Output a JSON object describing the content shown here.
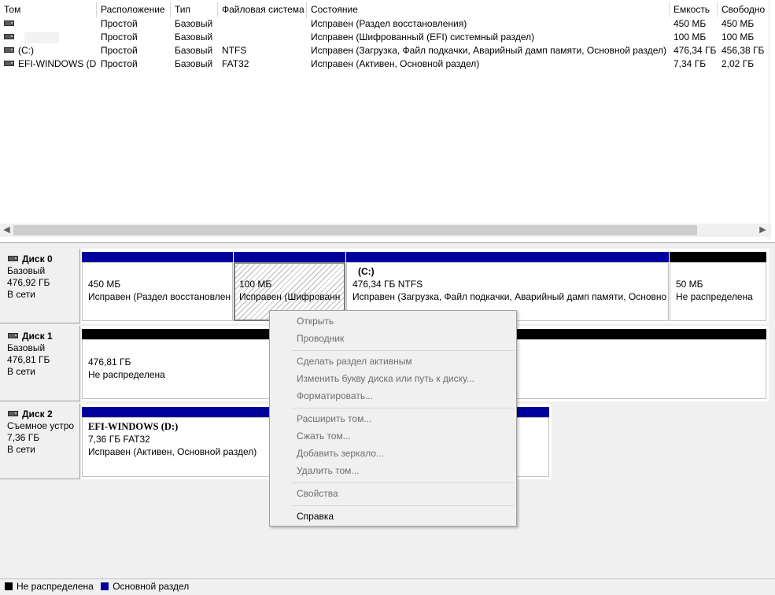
{
  "columns": [
    "Том",
    "Расположение",
    "Тип",
    "Файловая система",
    "Состояние",
    "Емкость",
    "Свободно"
  ],
  "volumes": [
    {
      "name": "",
      "layout": "Простой",
      "type": "Базовый",
      "fs": "",
      "status": "Исправен (Раздел восстановления)",
      "capacity": "450 МБ",
      "free": "450 МБ"
    },
    {
      "name": "",
      "layout": "Простой",
      "type": "Базовый",
      "fs": "",
      "status": "Исправен (Шифрованный (EFI) системный раздел)",
      "capacity": "100 МБ",
      "free": "100 МБ"
    },
    {
      "name": "(C:)",
      "layout": "Простой",
      "type": "Базовый",
      "fs": "NTFS",
      "status": "Исправен (Загрузка, Файл подкачки, Аварийный дамп памяти, Основной раздел)",
      "capacity": "476,34 ГБ",
      "free": "456,38 ГБ"
    },
    {
      "name": "EFI-WINDOWS (D:)",
      "layout": "Простой",
      "type": "Базовый",
      "fs": "FAT32",
      "status": "Исправен (Активен, Основной раздел)",
      "capacity": "7,34 ГБ",
      "free": "2,02 ГБ"
    }
  ],
  "disks": [
    {
      "name": "Диск 0",
      "type": "Базовый",
      "size": "476,92 ГБ",
      "state": "В сети",
      "partitions": [
        {
          "title": "",
          "size": "450 МБ",
          "status": "Исправен (Раздел восстановлен"
        },
        {
          "title": "",
          "size": "100 МБ",
          "status": "Исправен (Шифрованн"
        },
        {
          "title": "(C:)",
          "size": "476,34 ГБ NTFS",
          "status": "Исправен (Загрузка, Файл подкачки, Аварийный дамп памяти, Основно"
        },
        {
          "title": "",
          "size": "50 МБ",
          "status": "Не распределена"
        }
      ]
    },
    {
      "name": "Диск 1",
      "type": "Базовый",
      "size": "476,81 ГБ",
      "state": "В сети",
      "partitions": [
        {
          "title": "",
          "size": "476,81 ГБ",
          "status": "Не распределена"
        }
      ]
    },
    {
      "name": "Диск 2",
      "type": "Съемное устро",
      "size": "7,36 ГБ",
      "state": "В сети",
      "partitions": [
        {
          "title": "EFI-WINDOWS  (D:)",
          "size": "7,36 ГБ FAT32",
          "status": "Исправен (Активен, Основной раздел)"
        }
      ]
    }
  ],
  "legend": [
    {
      "label": "Не распределена",
      "color": "#000000"
    },
    {
      "label": "Основной раздел",
      "color": "#00009c"
    }
  ],
  "context_menu": {
    "open": "Открыть",
    "explorer": "Проводник",
    "mark_active": "Сделать раздел активным",
    "change_letter": "Изменить букву диска или путь к диску...",
    "format": "Форматировать...",
    "extend": "Расширить том...",
    "shrink": "Сжать том...",
    "add_mirror": "Добавить зеркало...",
    "delete": "Удалить том...",
    "properties": "Свойства",
    "help": "Справка"
  },
  "icons": {
    "scroll_left": "◀",
    "scroll_right": "▶"
  }
}
